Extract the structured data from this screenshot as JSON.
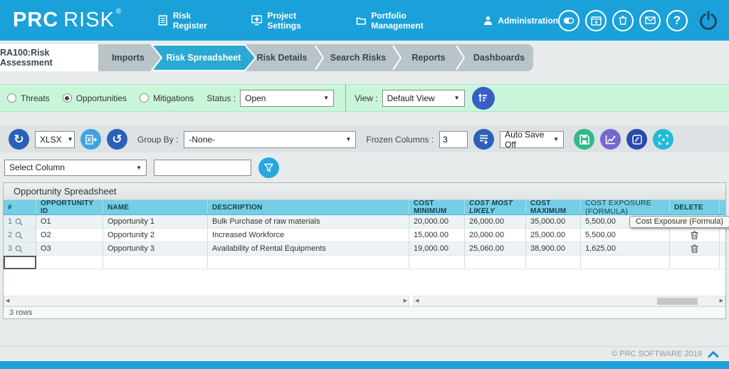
{
  "header": {
    "logo_prc": "PRC",
    "logo_risk": "RISK",
    "logo_reg": "®",
    "nav": [
      {
        "label": "Risk Register"
      },
      {
        "label": "Project Settings"
      },
      {
        "label": "Portfolio Management"
      },
      {
        "label": "Administration"
      }
    ],
    "help_label": "?"
  },
  "tabs": {
    "project_tab": "RA100:Risk Assessment",
    "items": [
      {
        "label": "Imports",
        "active": false
      },
      {
        "label": "Risk Spreadsheet",
        "active": true
      },
      {
        "label": "Risk Details",
        "active": false
      },
      {
        "label": "Search Risks",
        "active": false
      },
      {
        "label": "Reports",
        "active": false
      },
      {
        "label": "Dashboards",
        "active": false
      }
    ]
  },
  "filter_bar": {
    "radios": [
      {
        "label": "Threats",
        "selected": false
      },
      {
        "label": "Opportunities",
        "selected": true
      },
      {
        "label": "Mitigations",
        "selected": false
      }
    ],
    "status_label": "Status :",
    "status_value": "Open",
    "view_label": "View :",
    "view_value": "Default View"
  },
  "toolbar": {
    "export_format": "XLSX",
    "group_by_label": "Group By :",
    "group_by_value": "-None-",
    "frozen_label": "Frozen Columns :",
    "frozen_value": "3",
    "autosave_value": "Auto Save Off"
  },
  "column_filter": {
    "select_value": "Select Column",
    "input_value": ""
  },
  "spreadsheet": {
    "title": "Opportunity Spreadsheet",
    "columns": [
      "#",
      "OPPORTUNITY ID",
      "NAME",
      "DESCRIPTION",
      "COST MINIMUM",
      "COST MOST LIKELY",
      "COST MAXIMUM",
      "COST EXPOSURE (FORMULA)",
      "DELETE"
    ],
    "rows": [
      {
        "num": "1",
        "id": "O1",
        "name": "Opportunity 1",
        "description": "Bulk Purchase of raw materials",
        "cost_min": "20,000.00",
        "cost_most_likely": "26,000.00",
        "cost_max": "35,000.00",
        "cost_exposure": "5,500.00"
      },
      {
        "num": "2",
        "id": "O2",
        "name": "Opportunity 2",
        "description": "Increased Workforce",
        "cost_min": "15,000.00",
        "cost_most_likely": "20,000.00",
        "cost_max": "25,000.00",
        "cost_exposure": "5,500.00"
      },
      {
        "num": "3",
        "id": "O3",
        "name": "Opportunity 3",
        "description": "Availability of Rental Equipments",
        "cost_min": "19,000.00",
        "cost_most_likely": "25,060.00",
        "cost_max": "38,900.00",
        "cost_exposure": "1,625.00"
      }
    ],
    "tooltip": "Cost Exposure (Formula)",
    "row_count": "3 rows"
  },
  "footer": {
    "copyright": "© PRC SOFTWARE 2019"
  },
  "colors": {
    "header_blue": "#1ba1da",
    "active_tab_blue": "#2aa9d2",
    "filter_green": "#c9f6da",
    "table_header_blue": "#74cfe6",
    "royal_blue": "#2a60b9",
    "save_green": "#30b98a",
    "chart_purple": "#7668cf",
    "formula_navy": "#2b49ae",
    "region_teal": "#25bad6"
  }
}
